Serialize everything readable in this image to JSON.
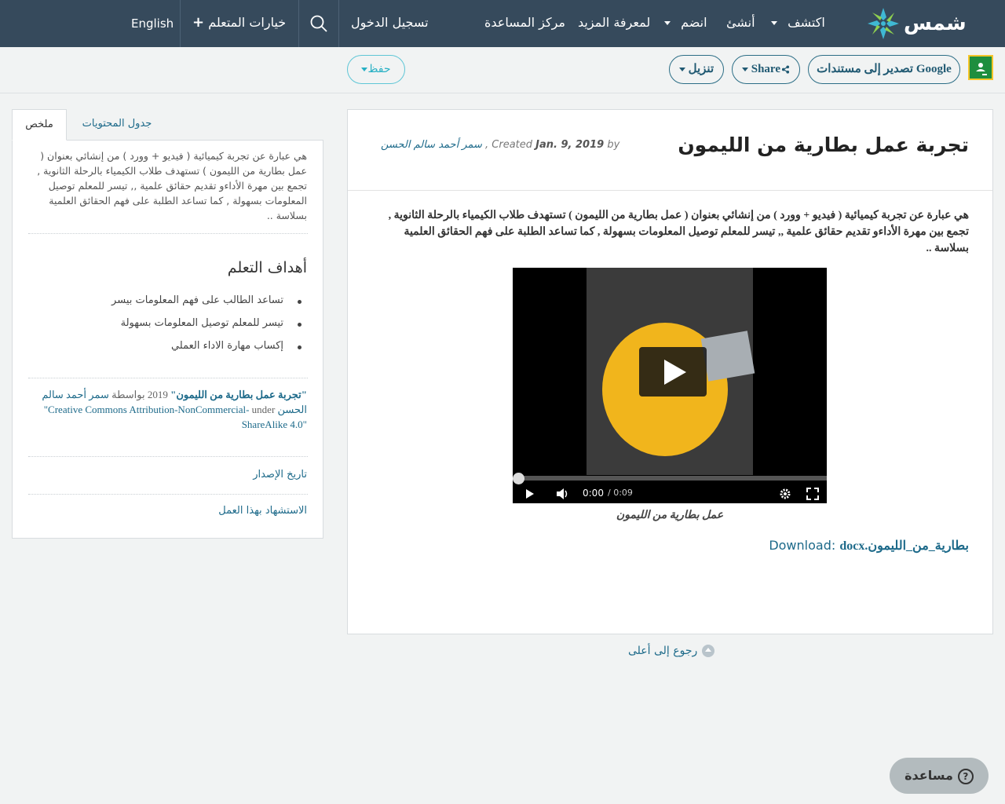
{
  "nav": {
    "brand": "شمس",
    "explore": "اكتشف",
    "create": "أنشئ",
    "join": "انضم",
    "learn_more": "لمعرفة المزيد",
    "help_center": "مركز المساعدة",
    "sign_in": "تسجيل الدخول",
    "learner_options": "خيارات المتعلم",
    "language": "English"
  },
  "toolbar": {
    "export_google": "تصدير إلى مستندات Google",
    "share": "Share",
    "download": "تنزيل",
    "save": "حفظ"
  },
  "resource": {
    "title": "تجربة عمل بطارية من الليمون",
    "by_label": "by",
    "date": "Jan. 9, 2019",
    "created_label": ", Created",
    "author": "سمر أحمد سالم الحسن",
    "description": "هي عبارة عن تجربة كيميائية ( فيديو + وورد ) من إنشائي بعنوان ( عمل بطارية من الليمون ) تستهدف طلاب الكيمياء بالرحلة الثانوية , تجمع بين مهرة الأداءو تقديم حقائق علمية ,, تيسر للمعلم توصيل المعلومات بسهولة , كما تساعد الطلبة على فهم الحقائق العلمية بسلاسة ..",
    "video": {
      "current_time": "0:00",
      "duration": "/ 0:09",
      "progress": 0,
      "caption": "عمل بطارية من الليمون"
    },
    "download_label": "Download:",
    "download_file": "بطارية_من_الليمون.docx"
  },
  "back_to_top": "رجوع إلى أعلى",
  "sidebar": {
    "tabs": [
      "ملخص",
      "جدول المحتويات"
    ],
    "summary": "هي عبارة عن تجربة كيميائية ( فيديو + وورد ) من إنشائي بعنوان ( عمل بطارية من الليمون ) تستهدف طلاب الكيمياء بالرحلة الثانوية , تجمع بين مهرة الأداءو تقديم حقائق علمية ,, تيسر للمعلم توصيل المعلومات بسهولة , كما تساعد الطلبة على فهم الحقائق العلمية بسلاسة ..",
    "goals_heading": "أهداف التعلم",
    "goals": [
      "تساعد الطالب على فهم المعلومات بيسر",
      "تيسر للمعلم توصيل المعلومات بسهولة",
      "إكساب مهارة الاداء العملي"
    ],
    "attribution": {
      "work_title": "\"تجربة عمل بطارية من الليمون\"",
      "year": "2019",
      "by_word": "بواسطة",
      "author": "سمر أحمد سالم الحسن",
      "under": "under",
      "license": "\"Creative Commons Attribution-NonCommercial-ShareAlike 4.0\""
    },
    "version_history": "تاريخ الإصدار",
    "cite_work": "الاستشهاد بهذا العمل"
  },
  "help_button": "مساعدة",
  "colors": {
    "nav_bg": "#364a5c",
    "link": "#1d6a8a",
    "save_accent": "#27b0c4"
  }
}
